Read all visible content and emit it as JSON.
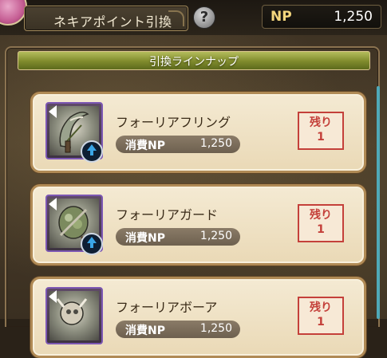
{
  "header": {
    "title": "ネキアポイント引換",
    "help_symbol": "?",
    "np_label": "NP",
    "np_value": "1,250"
  },
  "lineup": {
    "title": "引換ラインナップ"
  },
  "items": [
    {
      "name": "フォーリアフリング",
      "cost_label": "消費NP",
      "cost": "1,250",
      "remain_label": "残り",
      "remain_count": "1",
      "icon": "sickle-weapon-icon"
    },
    {
      "name": "フォーリアガード",
      "cost_label": "消費NP",
      "cost": "1,250",
      "remain_label": "残り",
      "remain_count": "1",
      "icon": "shield-guard-icon"
    },
    {
      "name": "フォーリアボーア",
      "cost_label": "消費NP",
      "cost": "1,250",
      "remain_label": "残り",
      "remain_count": "1",
      "icon": "boar-weapon-icon"
    }
  ],
  "colors": {
    "accent_gold": "#f4d77d",
    "lineup_green": "#7f8a2c",
    "remain_red": "#c4403a",
    "card_bg": "#f4ead3",
    "icon_frame_purple": "#7c57b3",
    "scroll_teal": "#4fa9b8"
  }
}
